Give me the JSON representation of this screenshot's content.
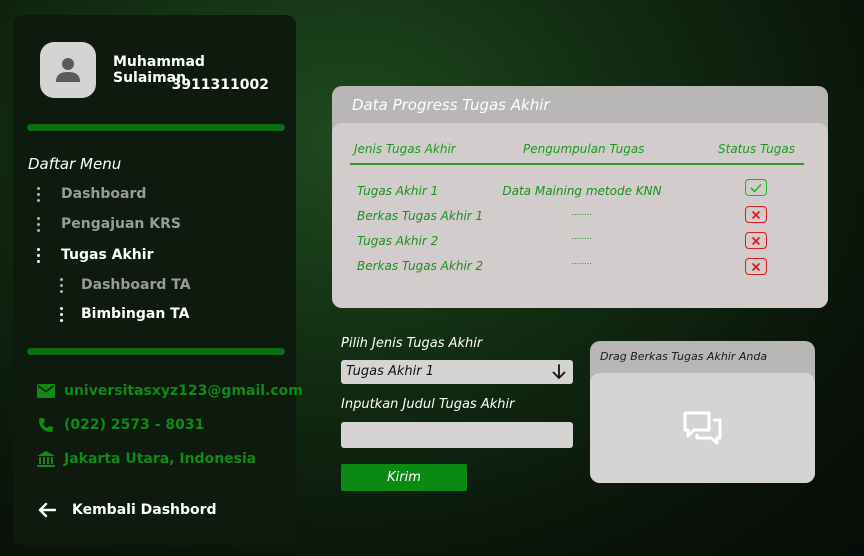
{
  "user": {
    "name": "Muhammad Sulaiman",
    "id": "3911311002"
  },
  "menu": {
    "title": "Daftar Menu",
    "items": [
      {
        "label": "Dashboard"
      },
      {
        "label": "Pengajuan KRS"
      },
      {
        "label": "Tugas Akhir"
      }
    ],
    "subitems": [
      {
        "label": "Dashboard TA"
      },
      {
        "label": "Bimbingan TA"
      }
    ]
  },
  "contacts": {
    "email": "universitasxyz123@gmail.com",
    "phone": "(022) 2573 - 8031",
    "address": "Jakarta Utara, Indonesia"
  },
  "back_label": "Kembali Dashbord",
  "progress": {
    "title": "Data Progress Tugas Akhir",
    "headers": [
      "Jenis Tugas Akhir",
      "Pengumpulan Tugas",
      "Status Tugas"
    ],
    "rows": [
      {
        "jenis": "Tugas Akhir 1",
        "pengumpulan": "Data Maining metode KNN",
        "status": "done"
      },
      {
        "jenis": "Berkas Tugas Akhir 1",
        "pengumpulan": "........",
        "status": "pending"
      },
      {
        "jenis": "Tugas Akhir 2",
        "pengumpulan": "........",
        "status": "pending"
      },
      {
        "jenis": "Berkas Tugas Akhir 2",
        "pengumpulan": "........",
        "status": "pending"
      }
    ]
  },
  "form": {
    "select_label": "Pilih Jenis Tugas Akhir",
    "select_value": "Tugas Akhir 1",
    "judul_label": "Inputkan Judul Tugas Akhir",
    "judul_value": "",
    "submit_label": "Kirim"
  },
  "upload": {
    "title": "Drag Berkas Tugas Akhir Anda"
  },
  "colors": {
    "accent": "#0d6b14",
    "success": "#1fb51f",
    "danger": "#d91c1c"
  }
}
